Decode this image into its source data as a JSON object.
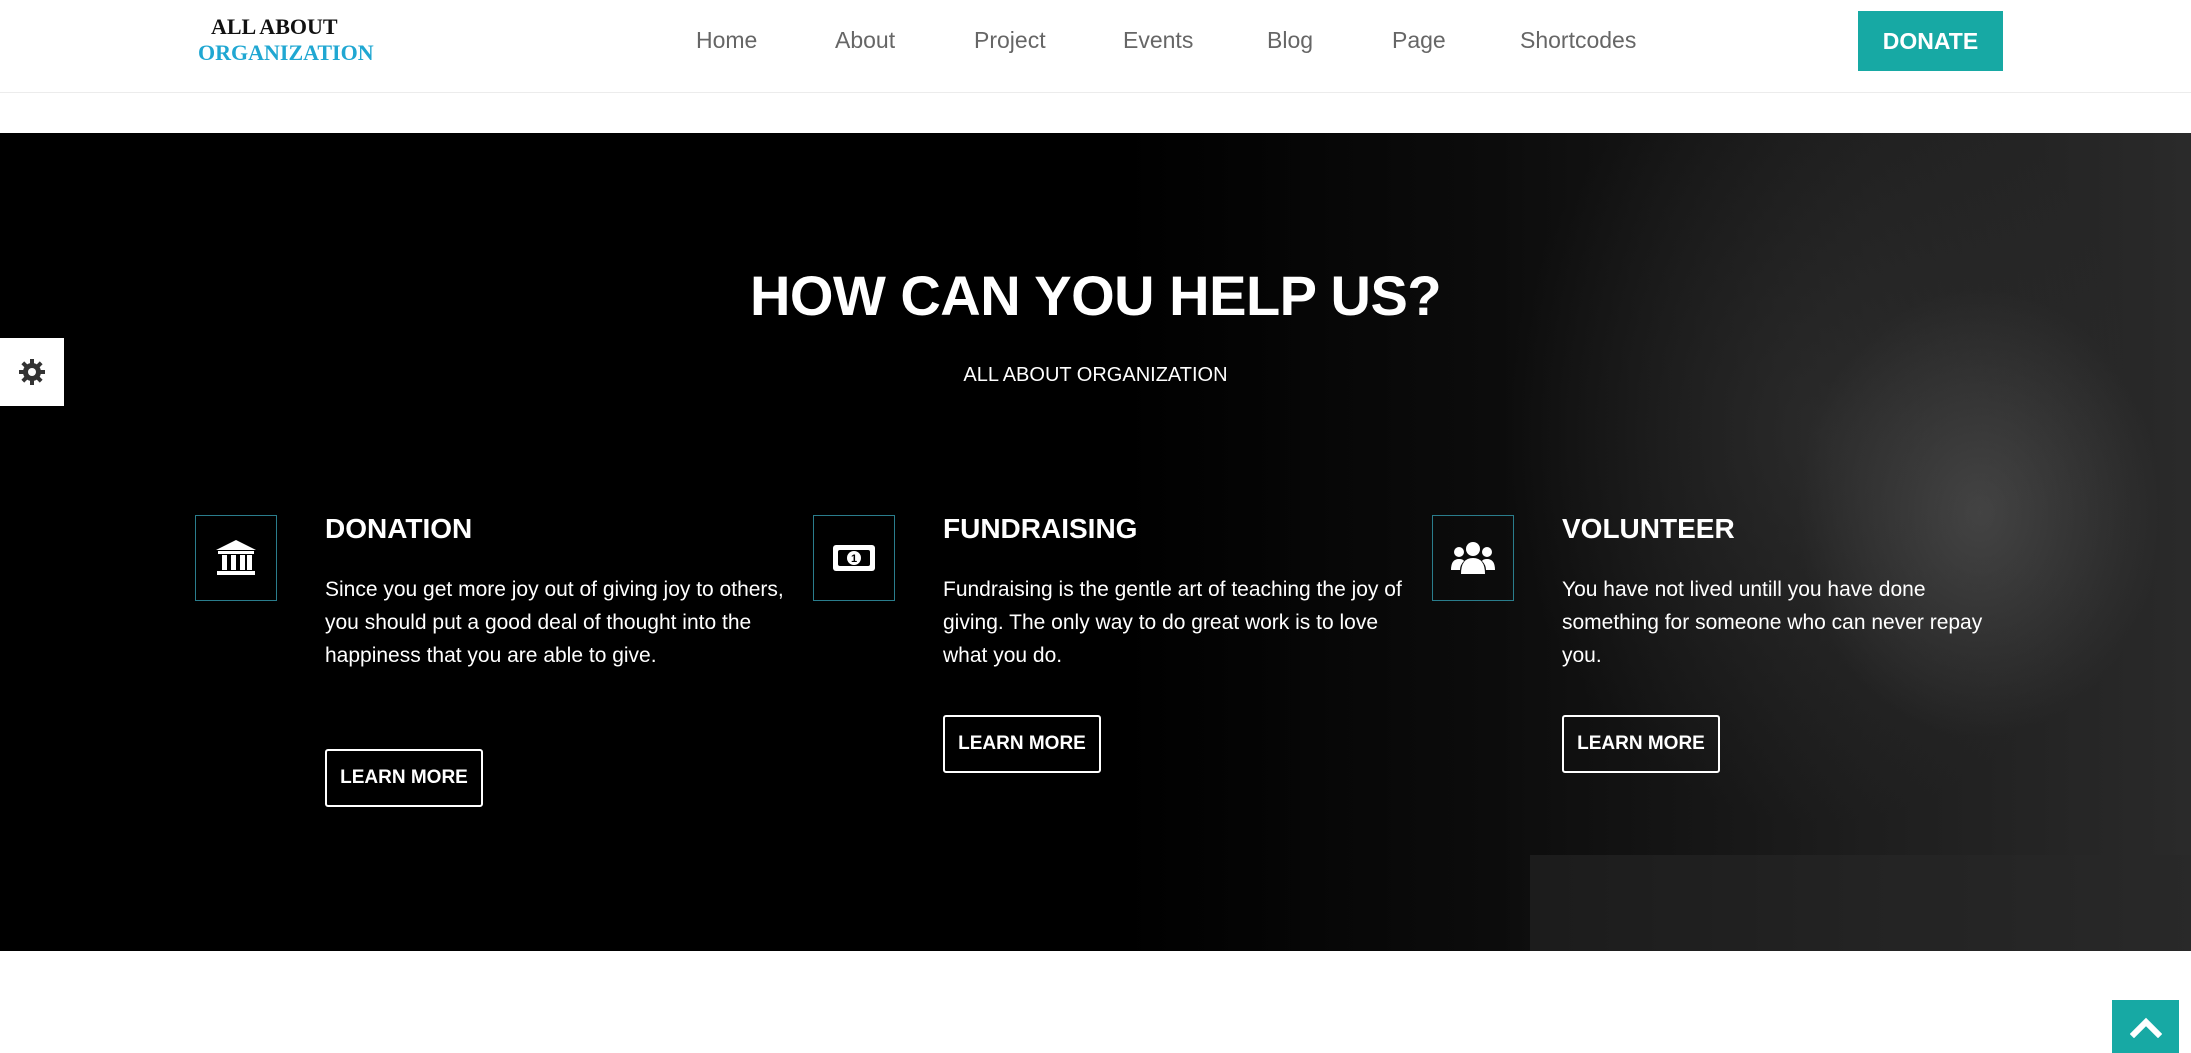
{
  "logo": {
    "line1": "ALL ABOUT",
    "line2": "ORGANIZATION"
  },
  "nav": [
    "Home",
    "About",
    "Project",
    "Events",
    "Blog",
    "Page",
    "Shortcodes"
  ],
  "donate_label": "DONATE",
  "hero": {
    "title": "HOW CAN YOU HELP US?",
    "subtitle": "ALL ABOUT ORGANIZATION"
  },
  "cards": [
    {
      "title": "DONATION",
      "text": "Since you get more joy out of giving joy to others, you should put a good deal of thought into the happiness that you are able to give.",
      "button": "LEARN MORE",
      "icon": "bank-icon"
    },
    {
      "title": "FUNDRAISING",
      "text": "Fundraising is the gentle art of teaching the joy of giving. The only way to do great work is to love what you do.",
      "button": "LEARN MORE",
      "icon": "money-icon"
    },
    {
      "title": "VOLUNTEER",
      "text": "You have not lived untill you have done something for someone who can never repay you.",
      "button": "LEARN MORE",
      "icon": "users-icon"
    }
  ],
  "colors": {
    "accent": "#17a9a4",
    "logo_blue": "#20a7d2",
    "icon_border": "#2a7d8c"
  }
}
